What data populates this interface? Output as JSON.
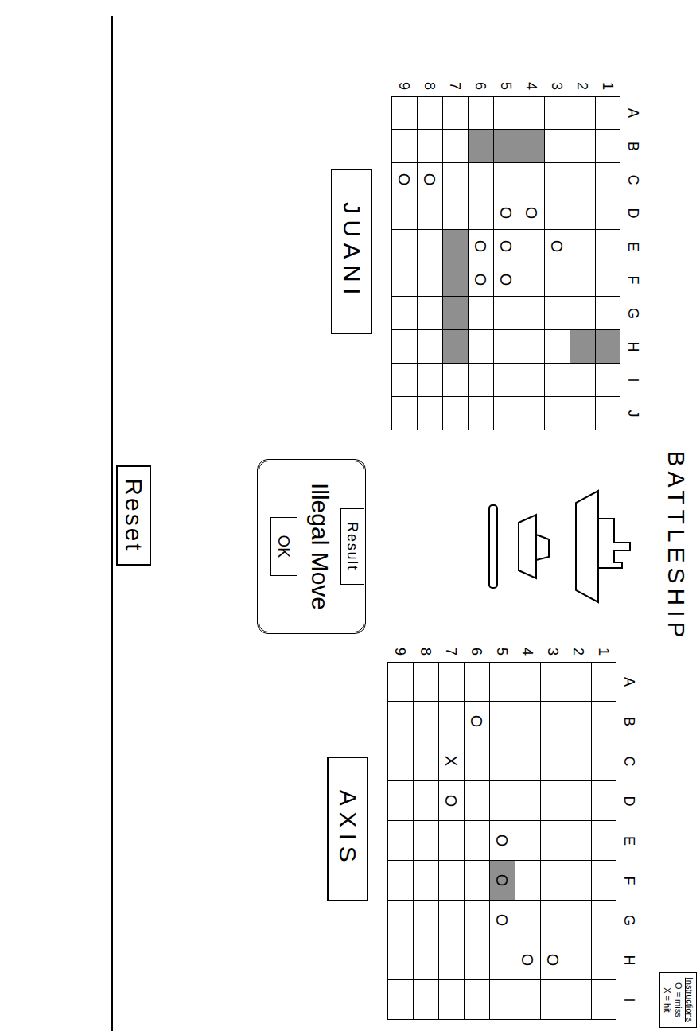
{
  "title": "BATTLESHIP",
  "instructions": {
    "title": "Instructions",
    "lines": [
      "O = miss",
      "X = hit"
    ]
  },
  "boards": [
    {
      "player": "JUANI",
      "columns": [
        "A",
        "B",
        "C",
        "D",
        "E",
        "F",
        "G",
        "H",
        "I",
        "J"
      ],
      "rows": [
        "1",
        "2",
        "3",
        "4",
        "5",
        "6",
        "7",
        "8",
        "9"
      ],
      "marks": [
        [
          "",
          "",
          "",
          "",
          "",
          "",
          "",
          "",
          "",
          ""
        ],
        [
          "",
          "",
          "",
          "",
          "",
          "",
          "",
          "",
          "",
          ""
        ],
        [
          "",
          "",
          "",
          "",
          "O",
          "",
          "",
          "",
          "",
          ""
        ],
        [
          "",
          "",
          "",
          "O",
          "",
          "",
          "",
          "",
          "",
          ""
        ],
        [
          "",
          "",
          "",
          "O",
          "O",
          "O",
          "",
          "",
          "",
          ""
        ],
        [
          "",
          "",
          "",
          "",
          "O",
          "O",
          "",
          "",
          "",
          ""
        ],
        [
          "",
          "",
          "",
          "",
          "",
          "",
          "",
          "",
          "",
          ""
        ],
        [
          "",
          "",
          "O",
          "",
          "",
          "",
          "",
          "",
          "",
          ""
        ],
        [
          "",
          "",
          "O",
          "",
          "",
          "",
          "",
          "",
          "",
          ""
        ]
      ],
      "shaded": [
        [
          false,
          false,
          false,
          false,
          false,
          false,
          false,
          true,
          false,
          false
        ],
        [
          false,
          false,
          false,
          false,
          false,
          false,
          false,
          true,
          false,
          false
        ],
        [
          false,
          false,
          false,
          false,
          false,
          false,
          false,
          false,
          false,
          false
        ],
        [
          false,
          true,
          false,
          false,
          false,
          false,
          false,
          false,
          false,
          false
        ],
        [
          false,
          true,
          false,
          false,
          false,
          false,
          false,
          false,
          false,
          false
        ],
        [
          false,
          true,
          false,
          false,
          false,
          false,
          false,
          false,
          false,
          false
        ],
        [
          false,
          false,
          false,
          false,
          true,
          true,
          true,
          true,
          false,
          false
        ],
        [
          false,
          false,
          false,
          false,
          false,
          false,
          false,
          false,
          false,
          false
        ],
        [
          false,
          false,
          false,
          false,
          false,
          false,
          false,
          false,
          false,
          false
        ]
      ]
    },
    {
      "player": "AXIS",
      "columns": [
        "A",
        "B",
        "C",
        "D",
        "E",
        "F",
        "G",
        "H",
        "I"
      ],
      "rows": [
        "1",
        "2",
        "3",
        "4",
        "5",
        "6",
        "7",
        "8",
        "9"
      ],
      "marks": [
        [
          "",
          "",
          "",
          "",
          "",
          "",
          "",
          "",
          ""
        ],
        [
          "",
          "",
          "",
          "",
          "",
          "",
          "",
          "",
          ""
        ],
        [
          "",
          "",
          "",
          "",
          "",
          "",
          "",
          "O",
          ""
        ],
        [
          "",
          "",
          "",
          "",
          "",
          "",
          "",
          "O",
          ""
        ],
        [
          "",
          "",
          "",
          "",
          "O",
          "O",
          "O",
          "",
          ""
        ],
        [
          "",
          "O",
          "",
          "",
          "",
          "",
          "",
          "",
          ""
        ],
        [
          "",
          "",
          "X",
          "O",
          "",
          "",
          "",
          "",
          ""
        ],
        [
          "",
          "",
          "",
          "",
          "",
          "",
          "",
          "",
          ""
        ],
        [
          "",
          "",
          "",
          "",
          "",
          "",
          "",
          "",
          ""
        ]
      ],
      "shaded": [
        [
          false,
          false,
          false,
          false,
          false,
          false,
          false,
          false,
          false
        ],
        [
          false,
          false,
          false,
          false,
          false,
          false,
          false,
          false,
          false
        ],
        [
          false,
          false,
          false,
          false,
          false,
          false,
          false,
          false,
          false
        ],
        [
          false,
          false,
          false,
          false,
          false,
          false,
          false,
          false,
          false
        ],
        [
          false,
          false,
          false,
          false,
          false,
          true,
          false,
          false,
          false
        ],
        [
          false,
          false,
          false,
          false,
          false,
          false,
          false,
          false,
          false
        ],
        [
          false,
          false,
          false,
          false,
          false,
          false,
          false,
          false,
          false
        ],
        [
          false,
          false,
          false,
          false,
          false,
          false,
          false,
          false,
          false
        ],
        [
          false,
          false,
          false,
          false,
          false,
          false,
          false,
          false,
          false
        ]
      ]
    }
  ],
  "dialog": {
    "title": "Result",
    "message": "Illegal Move",
    "button": "OK"
  },
  "reset": "Reset"
}
